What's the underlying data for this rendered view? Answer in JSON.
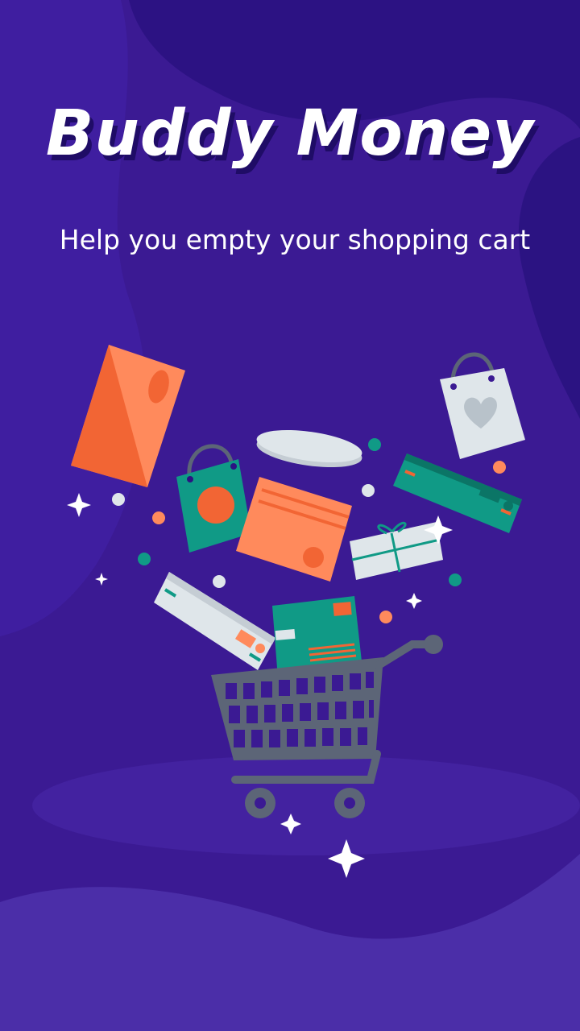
{
  "splash": {
    "title": "Buddy Money",
    "tagline": "Help you empty your shopping cart"
  },
  "colors": {
    "background": "#3b1a93",
    "background_dark": "#2b1382",
    "background_light": "#4a2ba6",
    "orange": "#f4673a",
    "orange_light": "#ff8a5c",
    "teal": "#109a86",
    "teal_dark": "#0b7566",
    "paper": "#dfe6ea",
    "cart": "#5c6577"
  },
  "icons": [
    "shopping-cart-icon",
    "shopping-bag-icon",
    "heart-bag-icon",
    "gift-box-icon",
    "sparkle-icon"
  ]
}
